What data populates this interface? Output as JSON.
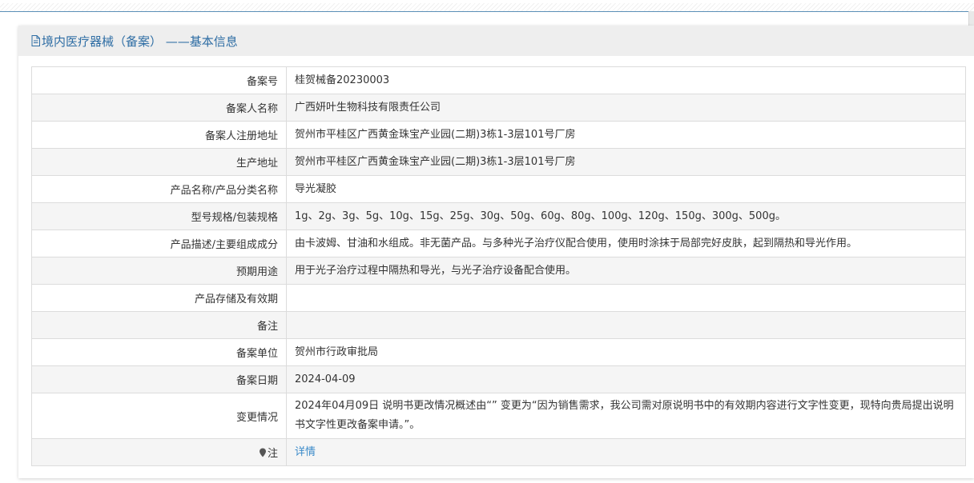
{
  "header": {
    "icon": "document-icon",
    "title": "境内医疗器械（备案） ——基本信息"
  },
  "rows": [
    {
      "label": "备案号",
      "value": "桂贺械备20230003"
    },
    {
      "label": "备案人名称",
      "value": "广西妍叶生物科技有限责任公司"
    },
    {
      "label": "备案人注册地址",
      "value": "贺州市平桂区广西黄金珠宝产业园(二期)3栋1-3层101号厂房"
    },
    {
      "label": "生产地址",
      "value": "贺州市平桂区广西黄金珠宝产业园(二期)3栋1-3层101号厂房"
    },
    {
      "label": "产品名称/产品分类名称",
      "value": "导光凝胶"
    },
    {
      "label": "型号规格/包装规格",
      "value": "1g、2g、3g、5g、10g、15g、25g、30g、50g、60g、80g、100g、120g、150g、300g、500g。"
    },
    {
      "label": "产品描述/主要组成成分",
      "value": "由卡波姆、甘油和水组成。非无菌产品。与多种光子治疗仪配合使用，使用时涂抹于局部完好皮肤，起到隔热和导光作用。"
    },
    {
      "label": "预期用途",
      "value": "用于光子治疗过程中隔热和导光，与光子治疗设备配合使用。"
    },
    {
      "label": "产品存储及有效期",
      "value": ""
    },
    {
      "label": "备注",
      "value": ""
    },
    {
      "label": "备案单位",
      "value": "贺州市行政审批局"
    },
    {
      "label": "备案日期",
      "value": "2024-04-09"
    },
    {
      "label": "变更情况",
      "value": "2024年04月09日 说明书更改情况概述由“” 变更为“因为销售需求，我公司需对原说明书中的有效期内容进行文字性变更，现特向贵局提出说明书文字性更改备案申请。”。"
    }
  ],
  "note": {
    "icon": "pin-icon",
    "label": "注",
    "link_text": "详情"
  },
  "colors": {
    "accent": "#2e6da4",
    "link": "#3a8ac9",
    "header_bg": "#eeeeee",
    "stripe_bg": "#f5f5f5",
    "border": "#dcdcdc"
  }
}
